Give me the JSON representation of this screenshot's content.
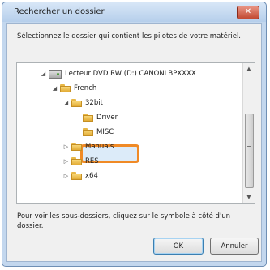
{
  "window": {
    "title": "Rechercher un dossier",
    "close_icon": "close-icon",
    "close_glyph": "✕"
  },
  "instruction": "Sélectionnez le dossier qui contient les pilotes de votre matériel.",
  "tree": {
    "items": [
      {
        "label": "Lecteur DVD RW (D:) CANONLBPXXXX",
        "expander": "◢",
        "icon": "dvd-drive-icon",
        "level": 0
      },
      {
        "label": "French",
        "expander": "◢",
        "icon": "folder-icon",
        "level": 1
      },
      {
        "label": "32bit",
        "expander": "◢",
        "icon": "folder-icon",
        "level": 2
      },
      {
        "label": "Driver",
        "expander": "",
        "icon": "folder-icon",
        "level": 3,
        "selected": true
      },
      {
        "label": "MISC",
        "expander": "",
        "icon": "folder-icon",
        "level": 3
      },
      {
        "label": "Manuals",
        "expander": "▷",
        "icon": "folder-icon",
        "level": 2
      },
      {
        "label": "RES",
        "expander": "▷",
        "icon": "folder-icon",
        "level": 2
      },
      {
        "label": "x64",
        "expander": "▷",
        "icon": "folder-icon",
        "level": 2
      }
    ],
    "highlight_color": "#f08a26"
  },
  "scrollbar": {
    "up_glyph": "▲",
    "down_glyph": "▼"
  },
  "footer_text": "Pour voir les sous-dossiers, cliquez sur le symbole à côté d'un dossier.",
  "buttons": {
    "ok": "OK",
    "cancel": "Annuler"
  }
}
